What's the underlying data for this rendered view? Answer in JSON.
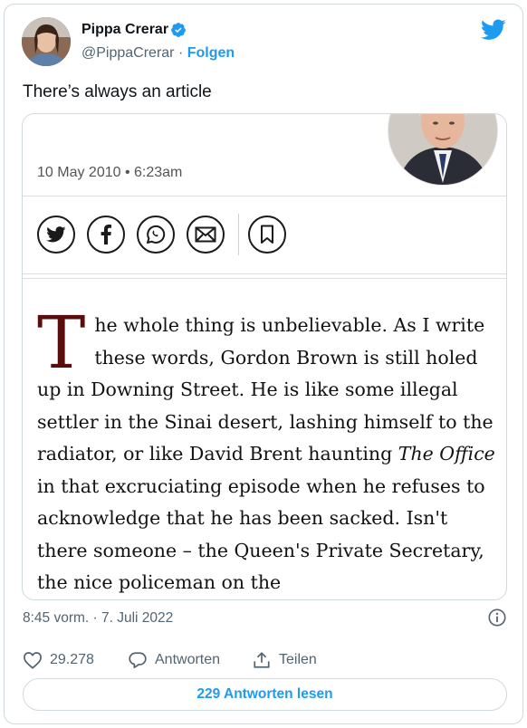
{
  "author": {
    "name": "Pippa Crerar",
    "handle": "@PippaCrerar",
    "separator": " · ",
    "follow_label": "Folgen"
  },
  "tweet": {
    "text": "There’s always an article"
  },
  "embed": {
    "date": "10 May 2010 • 6:23am",
    "share_buttons": [
      "twitter-icon",
      "facebook-icon",
      "whatsapp-icon",
      "email-icon",
      "bookmark-icon"
    ],
    "drop_cap": "T",
    "para_line1": "he whole thing is unbelievable. As I write these words, Gordon Brown is still holed up in Downing Street. He is like some illegal settler in the Sinai desert, lashing himself to the radiator, or like David Brent haunting ",
    "italic": "The Office",
    "para_line2": " in that excruciating episode when he refuses to acknowledge that he has been sacked. Isn't there someone – the Queen's Private Secretary, the nice policeman on the"
  },
  "meta": {
    "timestamp": "8:45 vorm. · 7. Juli 2022"
  },
  "actions": {
    "likes_count": "29.278",
    "reply_label": "Antworten",
    "share_label": "Teilen"
  },
  "replies_button_label": "229 Antworten lesen",
  "colors": {
    "twitter_blue": "#1d9bf0",
    "drop_cap": "#5a0d0d",
    "muted": "#536471"
  }
}
